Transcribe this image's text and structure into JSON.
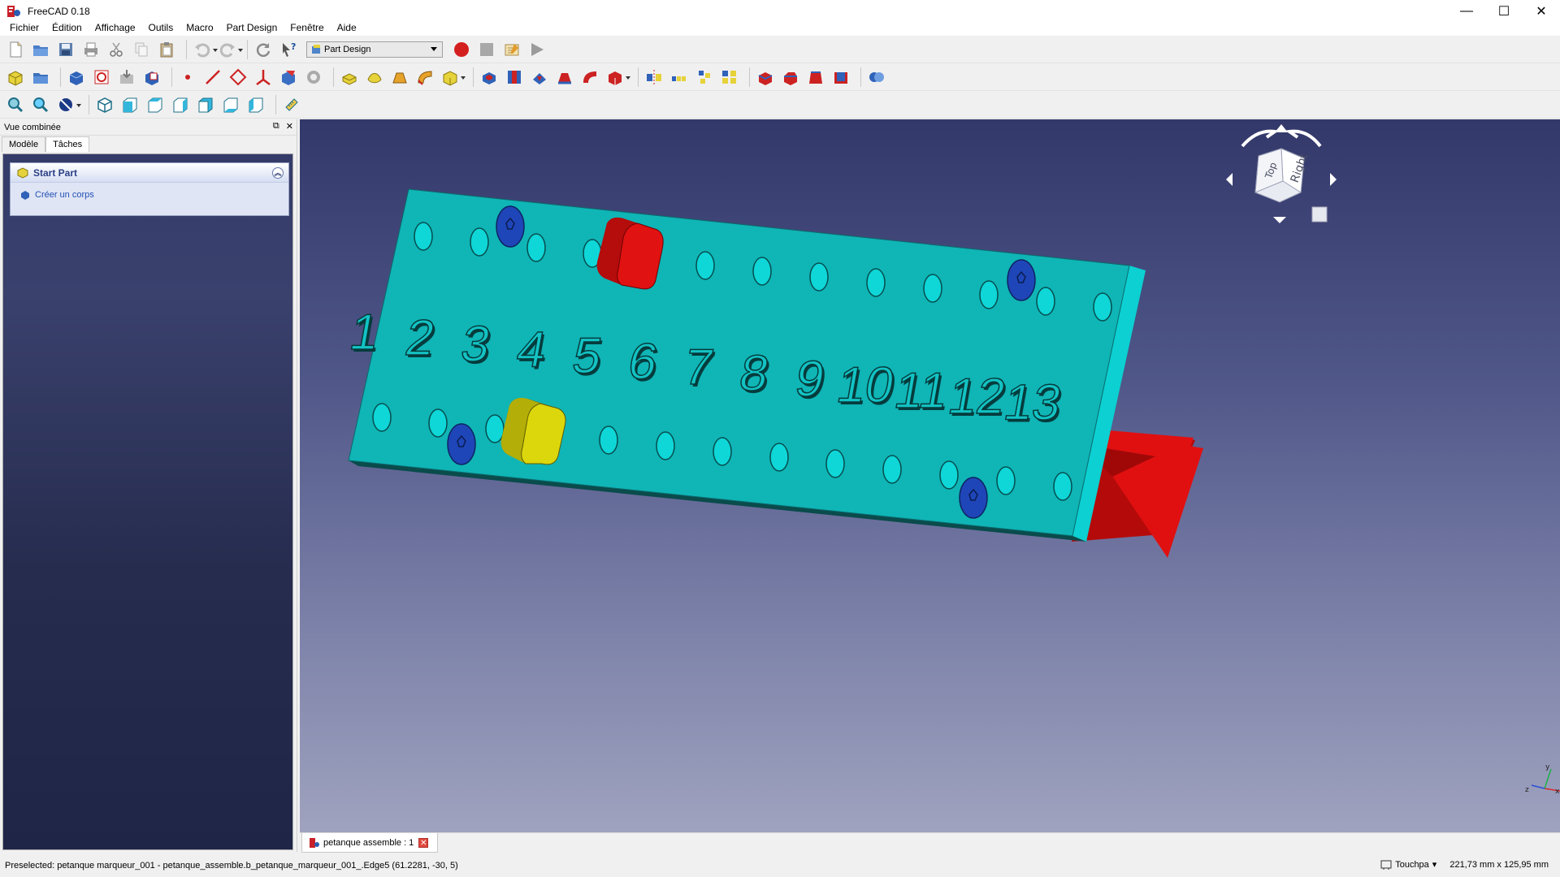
{
  "window": {
    "title": "FreeCAD 0.18",
    "controls": {
      "minimize": "—",
      "maximize": "☐",
      "close": "✕"
    }
  },
  "menu": [
    "Fichier",
    "Édition",
    "Affichage",
    "Outils",
    "Macro",
    "Part Design",
    "Fenêtre",
    "Aide"
  ],
  "workbench": {
    "selected": "Part Design"
  },
  "toolbar_icons": {
    "file": [
      "new-document-icon",
      "open-document-icon",
      "save-icon",
      "print-icon",
      "cut-icon",
      "copy-icon",
      "paste-icon",
      "undo-icon",
      "redo-icon",
      "refresh-icon",
      "whats-this-icon"
    ],
    "macro": [
      "record-macro-icon",
      "stop-macro-icon",
      "edit-macro-icon",
      "run-macro-icon"
    ]
  },
  "combo_view": {
    "title": "Vue combinée",
    "tabs": [
      "Modèle",
      "Tâches"
    ],
    "active_tab": "Tâches",
    "task_panel": {
      "header": "Start Part",
      "actions": [
        "Créer un corps"
      ]
    }
  },
  "viewport": {
    "navcube": {
      "face_top": "Top",
      "face_right": "Right"
    },
    "board_numbers": [
      "1",
      "2",
      "3",
      "4",
      "5",
      "6",
      "7",
      "8",
      "9",
      "10",
      "11",
      "12",
      "13"
    ],
    "axis_labels": {
      "x": "x",
      "y": "y",
      "z": "z"
    },
    "colors": {
      "board": "#10b5b6",
      "board_side": "#0cd0d2",
      "marker_red": "#cc0d0d",
      "marker_yellow": "#d6d10a",
      "screw_blue": "#1f46b8",
      "stand_red": "#e01010"
    }
  },
  "document_tab": {
    "label": "petanque assemble : 1"
  },
  "status": {
    "message": "Preselected: petanque marqueur_001 - petanque_assemble.b_petanque_marqueur_001_.Edge5 (61.2281, -30, 5)",
    "navigation_style": "Touchpa",
    "dimensions": "221,73 mm x 125,95 mm"
  }
}
